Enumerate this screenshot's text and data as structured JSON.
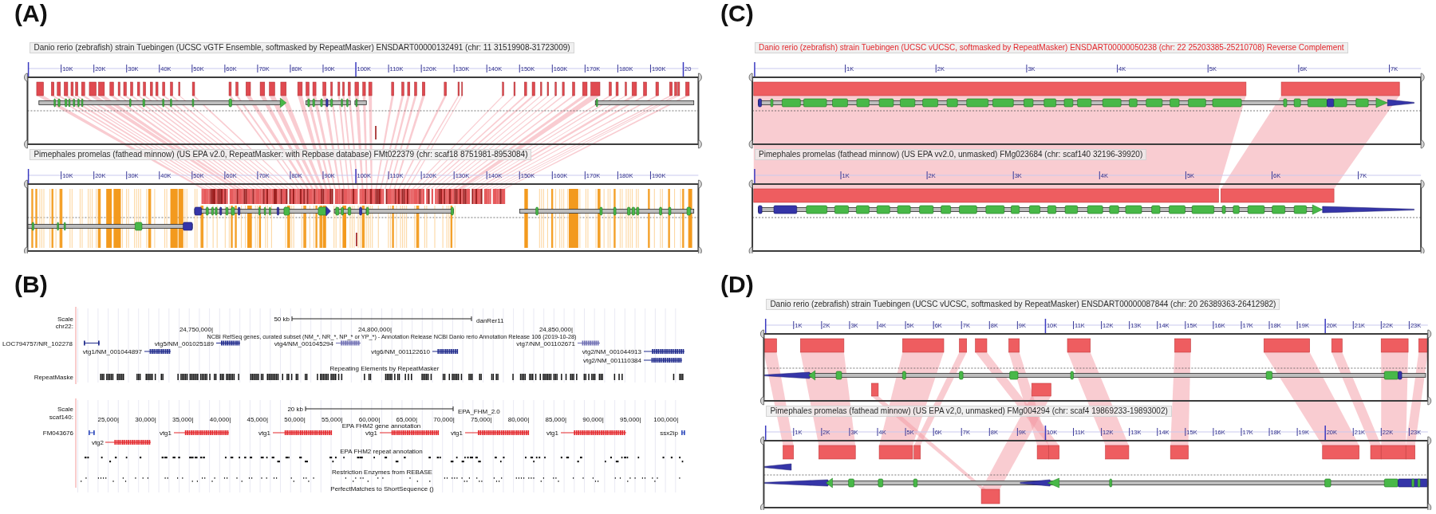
{
  "panels": [
    {
      "label": "(A)",
      "kind": "synteny",
      "tracks": [
        {
          "title": "Danio rerio (zebrafish) strain Tuebingen (UCSC vGTF Ensemble, softmasked by RepeatMasker) ENSDART00000132491 (chr: 11 31519908-31723009)",
          "reverse_complement": false,
          "ticks": [
            "10K",
            "20K",
            "30K",
            "40K",
            "50K",
            "60K",
            "70K",
            "80K",
            "90K",
            "100K",
            "110K",
            "120K",
            "130K",
            "140K",
            "150K",
            "160K",
            "170K",
            "180K",
            "190K",
            "20"
          ]
        },
        {
          "title": "Pimephales promelas (fathead minnow) (US EPA v2.0, RepeatMasker: with Repbase database) FMt022379 (chr: scaf18 8751981-8953084)",
          "reverse_complement": false,
          "ticks": [
            "10K",
            "20K",
            "30K",
            "40K",
            "50K",
            "60K",
            "70K",
            "80K",
            "90K",
            "100K",
            "110K",
            "120K",
            "130K",
            "140K",
            "150K",
            "160K",
            "170K",
            "180K",
            "190K"
          ]
        }
      ]
    },
    {
      "label": "(C)",
      "kind": "synteny",
      "tracks": [
        {
          "title": "Danio rerio (zebrafish) strain Tuebingen (UCSC vUCSC, softmasked by RepeatMasker) ENSDART00000050238 (chr: 22 25203385-25210708) Reverse Complement",
          "reverse_complement": true,
          "ticks": [
            "1K",
            "2K",
            "3K",
            "4K",
            "5K",
            "6K",
            "7K"
          ]
        },
        {
          "title": "Pimephales promelas (fathead minnow) (US EPA vv2.0, unmasked) FMg023684 (chr: scaf140 32196-39920)",
          "reverse_complement": false,
          "ticks": [
            "1K",
            "2K",
            "3K",
            "4K",
            "5K",
            "6K",
            "7K"
          ]
        }
      ]
    },
    {
      "label": "(B)",
      "kind": "browser",
      "views": [
        {
          "scale_label": "Scale",
          "sequence": "chr22:",
          "scale_bar": "50 kb",
          "assembly": "danRer11",
          "positions": [
            "24,750,000|",
            "24,800,000|",
            "24,850,000|"
          ],
          "tracks": [
            {
              "kind": "genes",
              "title": "NCBI RefSeq genes, curated subset (NM_*, NR_*, NP_* or YP_*) - Annotation Release NCBI Danio rerio Annotation Release 106 (2019-10-28)",
              "genes": [
                {
                  "name": "LOC794757/NR_102278",
                  "color": "#1f2a8c"
                },
                {
                  "name": "vtg5/NM_001025189",
                  "color": "#1f2a8c"
                },
                {
                  "name": "vtg4/NM_001045294",
                  "color": "#6f6fb3"
                },
                {
                  "name": "vtg7/NM_001102671",
                  "color": "#6f6fb3"
                },
                {
                  "name": "vtg1/NM_001044897",
                  "color": "#1f2a8c"
                },
                {
                  "name": "vtg6/NM_001122610",
                  "color": "#1f2a8c"
                },
                {
                  "name": "vtg2/NM_001044913",
                  "color": "#1f2a8c"
                },
                {
                  "name": "vtg2/NM_001110384",
                  "color": "#1f2a8c"
                }
              ]
            },
            {
              "kind": "repeats",
              "title": "Repeating Elements by RepeatMasker",
              "side_label": "RepeatMaske"
            }
          ]
        },
        {
          "scale_label": "Scale",
          "sequence": "scaf140:",
          "scale_bar": "20 kb",
          "assembly": "EPA_FHM_2.0",
          "positions": [
            "25,000|",
            "30,000|",
            "35,000|",
            "40,000|",
            "45,000|",
            "50,000|",
            "55,000|",
            "60,000|",
            "65,000|",
            "70,000|",
            "75,000|",
            "80,000|",
            "85,000|",
            "90,000|",
            "95,000|",
            "100,000|"
          ],
          "tracks": [
            {
              "kind": "genes",
              "title": "EPA FHM2 gene annotation",
              "genes": [
                {
                  "name": "FM043676",
                  "color": "#3b55c0"
                },
                {
                  "name": "vtg2",
                  "color": "#e3262b"
                },
                {
                  "name": "vtg1",
                  "color": "#e3262b"
                },
                {
                  "name": "vtg1",
                  "color": "#e3262b"
                },
                {
                  "name": "vtg1",
                  "color": "#e3262b"
                },
                {
                  "name": "vtg1",
                  "color": "#e3262b"
                },
                {
                  "name": "vtg1",
                  "color": "#e3262b"
                },
                {
                  "name": "ssx2ip",
                  "color": "#3b55c0"
                }
              ]
            },
            {
              "kind": "repeats",
              "title": "EPA FHM2 repeat annotation"
            },
            {
              "kind": "sites",
              "title": "Restriction Enzymes from REBASE"
            },
            {
              "kind": "matches",
              "title": "PerfectMatches to ShortSequence ()"
            }
          ]
        }
      ]
    },
    {
      "label": "(D)",
      "kind": "synteny",
      "tracks": [
        {
          "title": "Danio rerio (zebrafish) strain Tuebingen (UCSC vUCSC, softmasked by RepeatMasker) ENSDART00000087844 (chr: 20 26389363-26412982)",
          "reverse_complement": false,
          "ticks": [
            "1K",
            "2K",
            "3K",
            "4K",
            "5K",
            "6K",
            "7K",
            "8K",
            "9K",
            "10K",
            "11K",
            "12K",
            "13K",
            "14K",
            "15K",
            "16K",
            "17K",
            "18K",
            "19K",
            "20K",
            "21K",
            "22K",
            "23K"
          ]
        },
        {
          "title": "Pimephales promelas (fathead minnow) (US EPA v2,0, unmasked) FMg004294 (chr: scaf4 19869233-19893002)",
          "reverse_complement": false,
          "ticks": [
            "1K",
            "2K",
            "3K",
            "4K",
            "5K",
            "6K",
            "7K",
            "8K",
            "9K",
            "10K",
            "11K",
            "12K",
            "13K",
            "14K",
            "15K",
            "16K",
            "17K",
            "18K",
            "19K",
            "20K",
            "21K",
            "22K",
            "23K"
          ]
        }
      ]
    }
  ]
}
